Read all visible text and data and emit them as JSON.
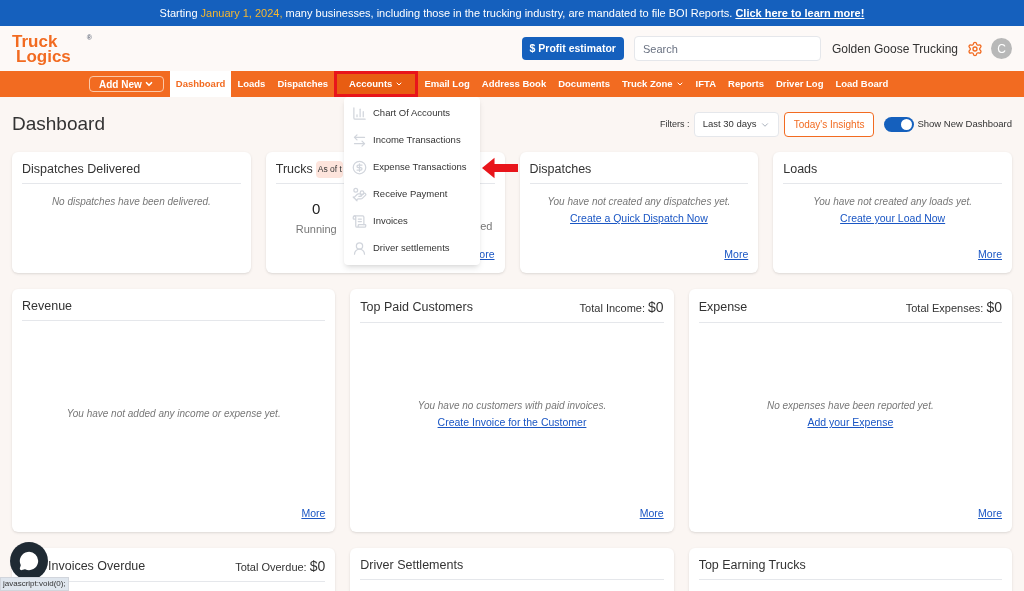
{
  "banner": {
    "before": "Starting ",
    "highlight": "January 1, 2024,",
    "after": " many businesses, including those in the trucking industry, are mandated to file BOI Reports. ",
    "link": "Click here to learn more!"
  },
  "header": {
    "logo": [
      "Truck",
      "Logics"
    ],
    "logo_mark": "®",
    "profit_button": "$ Profit estimator",
    "search_placeholder": "Search",
    "company": "Golden Goose Trucking",
    "avatar": "C"
  },
  "nav": {
    "add_new": "Add New",
    "items": [
      {
        "label": "Dashboard",
        "selected": true,
        "has_menu": false,
        "expanded": false
      },
      {
        "label": "Loads",
        "selected": false,
        "has_menu": false,
        "expanded": false
      },
      {
        "label": "Dispatches",
        "selected": false,
        "has_menu": false,
        "expanded": false
      },
      {
        "label": "Accounts",
        "selected": false,
        "has_menu": true,
        "expanded": true
      },
      {
        "label": "Email Log",
        "selected": false,
        "has_menu": false,
        "expanded": false
      },
      {
        "label": "Address Book",
        "selected": false,
        "has_menu": false,
        "expanded": false
      },
      {
        "label": "Documents",
        "selected": false,
        "has_menu": false,
        "expanded": false
      },
      {
        "label": "Truck Zone",
        "selected": false,
        "has_menu": true,
        "expanded": false
      },
      {
        "label": "IFTA",
        "selected": false,
        "has_menu": false,
        "expanded": false
      },
      {
        "label": "Reports",
        "selected": false,
        "has_menu": false,
        "expanded": false
      },
      {
        "label": "Driver Log",
        "selected": false,
        "has_menu": false,
        "expanded": false
      },
      {
        "label": "Load Board",
        "selected": false,
        "has_menu": false,
        "expanded": false
      }
    ]
  },
  "accounts_menu": [
    {
      "label": "Chart Of Accounts",
      "kind": "chart"
    },
    {
      "label": "Income Transactions",
      "kind": "exchange"
    },
    {
      "label": "Expense Transactions",
      "kind": "expense"
    },
    {
      "label": "Receive Payment",
      "kind": "payment"
    },
    {
      "label": "Invoices",
      "kind": "invoice"
    },
    {
      "label": "Driver settlements",
      "kind": "driver"
    }
  ],
  "page_title": "Dashboard",
  "filters": {
    "label": "Filters :",
    "value": "Last 30 days"
  },
  "insights_button": "Today's Insights",
  "new_dashboard_toggle": {
    "label": "Show New Dashboard",
    "on": true
  },
  "rows": [
    [
      {
        "title": "Dispatches Delivered",
        "message": "No dispatches have been delivered."
      },
      {
        "title": "Trucks",
        "badge": "As of t",
        "stats": [
          {
            "value": "0",
            "label": "Running"
          },
          {
            "label": "ed"
          }
        ],
        "more": "ore"
      },
      {
        "title": "Dispatches",
        "message": "You have not created any dispatches yet.",
        "link": "Create a Quick Dispatch Now",
        "more": "More"
      },
      {
        "title": "Loads",
        "message": "You have not created any loads yet.",
        "link": "Create your Load Now",
        "more": "More"
      }
    ],
    [
      {
        "title": "Revenue",
        "message": "You have not added any income or expense yet.",
        "more": "More"
      },
      {
        "title": "Top Paid Customers",
        "total_label": "Total Income:",
        "total_value": "$0",
        "message": "You have no customers with paid invoices.",
        "link": "Create Invoice for the Customer",
        "more": "More"
      },
      {
        "title": "Expense",
        "total_label": "Total Expenses:",
        "total_value": "$0",
        "message": "No expenses have been reported yet.",
        "link": "Add your Expense",
        "more": "More"
      }
    ],
    [
      {
        "title": "Invoices Overdue",
        "total_label": "Total Overdue:",
        "total_value": "$0",
        "covered": true
      },
      {
        "title": "Driver Settlements"
      },
      {
        "title": "Top Earning Trucks"
      }
    ]
  ],
  "status_tooltip": "javascript:void(0);"
}
